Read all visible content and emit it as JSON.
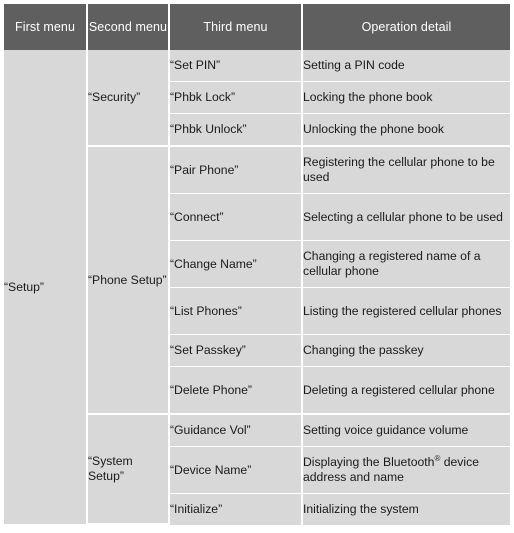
{
  "table": {
    "headers": [
      {
        "label": "First menu"
      },
      {
        "label": "Second menu"
      },
      {
        "label": "Third menu"
      },
      {
        "label": "Operation detail"
      }
    ],
    "first_menu": "“Setup”",
    "groups": [
      {
        "second_menu": "“Security”",
        "rows": [
          {
            "third_menu": "“Set PIN”",
            "detail": "Setting a PIN code"
          },
          {
            "third_menu": "“Phbk Lock”",
            "detail": "Locking the phone book"
          },
          {
            "third_menu": "“Phbk Unlock”",
            "detail": "Unlocking the phone book"
          }
        ]
      },
      {
        "second_menu": "“Phone Setup”",
        "rows": [
          {
            "third_menu": "“Pair Phone”",
            "detail": "Registering the cellular phone to be used"
          },
          {
            "third_menu": "“Connect”",
            "detail": "Selecting a cellular phone to be used"
          },
          {
            "third_menu": "“Change Name”",
            "detail": "Changing a registered name of a cellular phone"
          },
          {
            "third_menu": "“List Phones”",
            "detail": "Listing the registered cellular phones"
          },
          {
            "third_menu": "“Set Passkey”",
            "detail": "Changing the passkey"
          },
          {
            "third_menu": "“Delete Phone”",
            "detail": "Deleting a registered cellular phone"
          }
        ]
      },
      {
        "second_menu": "“System Setup”",
        "rows": [
          {
            "third_menu": "“Guidance Vol”",
            "detail": "Setting voice guidance volume"
          },
          {
            "third_menu": "“Device Name”",
            "detail_pre": "Displaying the Bluetooth",
            "detail_sup": "®",
            "detail_post": " device address and name"
          },
          {
            "third_menu": "“Initialize”",
            "detail": "Initializing the system"
          }
        ]
      }
    ]
  },
  "colors": {
    "header_background": "#5f5f5f",
    "header_text": "#ffffff",
    "cell_background": "#d8d8d8",
    "cell_text": "#1a1a1a",
    "grid_line": "#ffffff",
    "page_background": "#ffffff"
  }
}
